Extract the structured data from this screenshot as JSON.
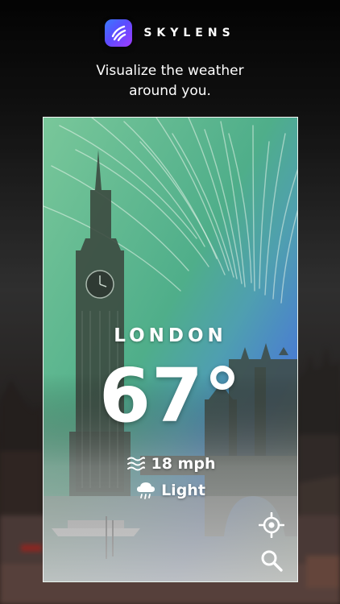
{
  "brand": {
    "name": "SKYLENS",
    "logo": "skylens-logo-icon",
    "logo_gradient": [
      "#3a7bff",
      "#a03cff"
    ]
  },
  "tagline": {
    "line1": "Visualize the weather",
    "line2": "around you."
  },
  "weather": {
    "city": "LONDON",
    "temperature": "67°",
    "wind": {
      "icon": "wind-icon",
      "value": "18 mph"
    },
    "precipitation": {
      "icon": "rain-cloud-icon",
      "value": "Light"
    }
  },
  "actions": {
    "locate_icon": "crosshair-locate-icon",
    "search_icon": "search-icon"
  },
  "colors": {
    "overlay_green": "#4fae8a",
    "overlay_blue": "#4a7fd0",
    "text": "#ffffff"
  }
}
